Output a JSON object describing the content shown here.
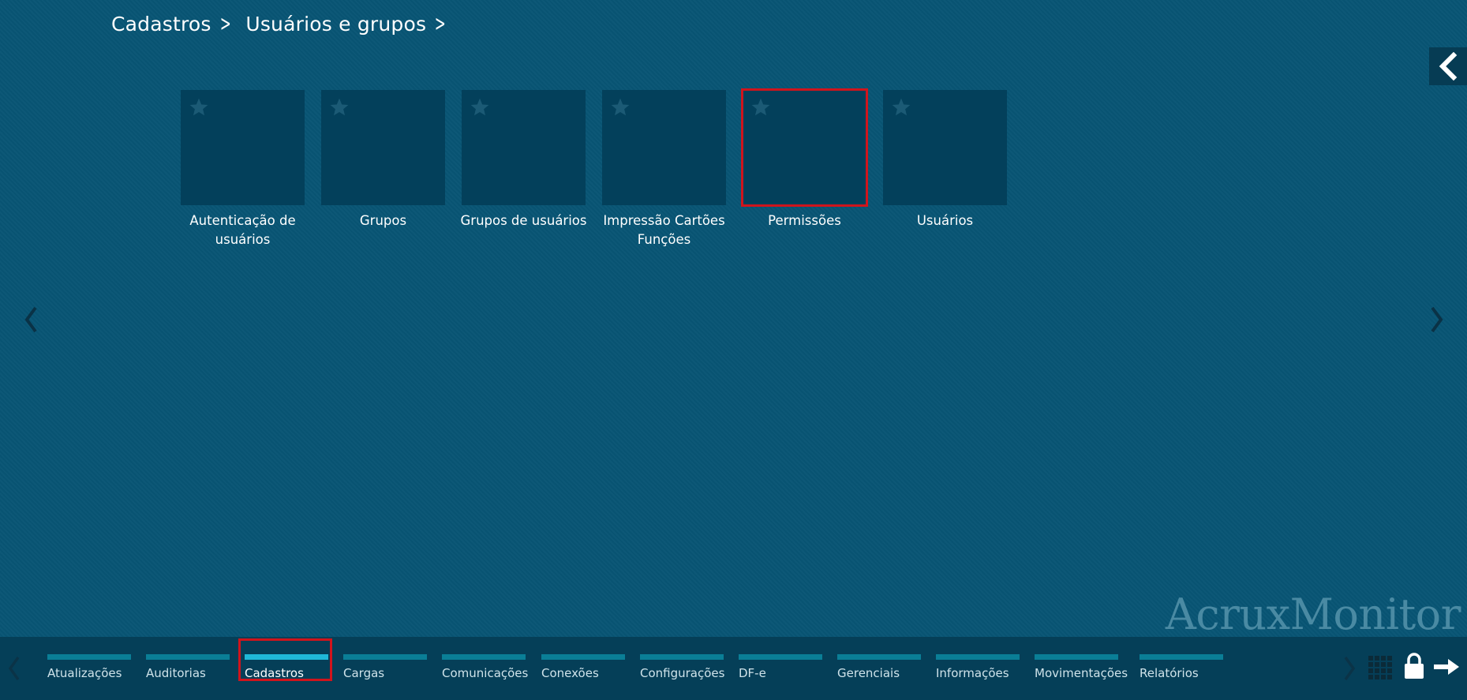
{
  "breadcrumb": [
    {
      "label": "Cadastros"
    },
    {
      "label": "Usuários e grupos"
    }
  ],
  "tiles": [
    {
      "label": "Autenticação de usuários",
      "highlighted": false
    },
    {
      "label": "Grupos",
      "highlighted": false
    },
    {
      "label": "Grupos de usuários",
      "highlighted": false
    },
    {
      "label": "Impressão Cartões Funções",
      "highlighted": false
    },
    {
      "label": "Permissões",
      "highlighted": true
    },
    {
      "label": "Usuários",
      "highlighted": false
    }
  ],
  "brand": {
    "text": "AcruxMonitor"
  },
  "categories": [
    {
      "label": "Atualizações"
    },
    {
      "label": "Auditorias"
    },
    {
      "label": "Cadastros",
      "active": true
    },
    {
      "label": "Cargas"
    },
    {
      "label": "Comunicações"
    },
    {
      "label": "Conexões"
    },
    {
      "label": "Configurações"
    },
    {
      "label": "DF-e"
    },
    {
      "label": "Gerenciais"
    },
    {
      "label": "Informações"
    },
    {
      "label": "Movimentações"
    },
    {
      "label": "Relatórios"
    }
  ],
  "icons": {
    "star": "star-icon",
    "collapse": "chevron-left-icon",
    "apps": "grid-icon",
    "lock": "lock-icon",
    "logout": "arrow-right-icon"
  },
  "colors": {
    "background": "#085574",
    "tile": "#03405b",
    "highlight": "#d0141c",
    "category_bar": "#0a7e96",
    "category_bar_active": "#1fb8d8",
    "bottom_bar": "#053f58"
  }
}
